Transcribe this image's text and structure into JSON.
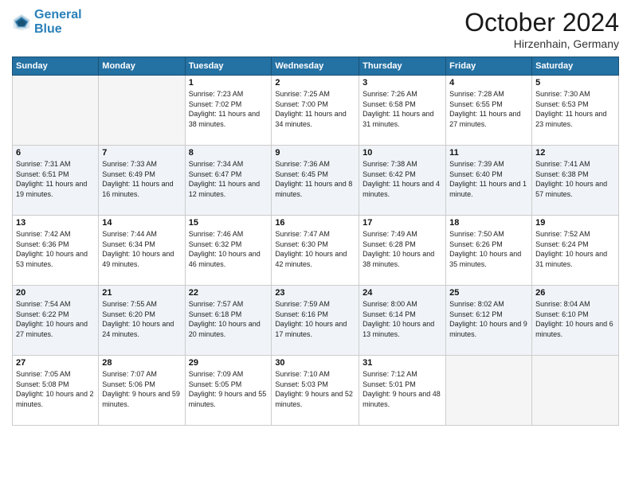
{
  "header": {
    "logo_line1": "General",
    "logo_line2": "Blue",
    "month": "October 2024",
    "location": "Hirzenhain, Germany"
  },
  "weekdays": [
    "Sunday",
    "Monday",
    "Tuesday",
    "Wednesday",
    "Thursday",
    "Friday",
    "Saturday"
  ],
  "weeks": [
    [
      {
        "day": "",
        "info": ""
      },
      {
        "day": "",
        "info": ""
      },
      {
        "day": "1",
        "info": "Sunrise: 7:23 AM\nSunset: 7:02 PM\nDaylight: 11 hours and 38 minutes."
      },
      {
        "day": "2",
        "info": "Sunrise: 7:25 AM\nSunset: 7:00 PM\nDaylight: 11 hours and 34 minutes."
      },
      {
        "day": "3",
        "info": "Sunrise: 7:26 AM\nSunset: 6:58 PM\nDaylight: 11 hours and 31 minutes."
      },
      {
        "day": "4",
        "info": "Sunrise: 7:28 AM\nSunset: 6:55 PM\nDaylight: 11 hours and 27 minutes."
      },
      {
        "day": "5",
        "info": "Sunrise: 7:30 AM\nSunset: 6:53 PM\nDaylight: 11 hours and 23 minutes."
      }
    ],
    [
      {
        "day": "6",
        "info": "Sunrise: 7:31 AM\nSunset: 6:51 PM\nDaylight: 11 hours and 19 minutes."
      },
      {
        "day": "7",
        "info": "Sunrise: 7:33 AM\nSunset: 6:49 PM\nDaylight: 11 hours and 16 minutes."
      },
      {
        "day": "8",
        "info": "Sunrise: 7:34 AM\nSunset: 6:47 PM\nDaylight: 11 hours and 12 minutes."
      },
      {
        "day": "9",
        "info": "Sunrise: 7:36 AM\nSunset: 6:45 PM\nDaylight: 11 hours and 8 minutes."
      },
      {
        "day": "10",
        "info": "Sunrise: 7:38 AM\nSunset: 6:42 PM\nDaylight: 11 hours and 4 minutes."
      },
      {
        "day": "11",
        "info": "Sunrise: 7:39 AM\nSunset: 6:40 PM\nDaylight: 11 hours and 1 minute."
      },
      {
        "day": "12",
        "info": "Sunrise: 7:41 AM\nSunset: 6:38 PM\nDaylight: 10 hours and 57 minutes."
      }
    ],
    [
      {
        "day": "13",
        "info": "Sunrise: 7:42 AM\nSunset: 6:36 PM\nDaylight: 10 hours and 53 minutes."
      },
      {
        "day": "14",
        "info": "Sunrise: 7:44 AM\nSunset: 6:34 PM\nDaylight: 10 hours and 49 minutes."
      },
      {
        "day": "15",
        "info": "Sunrise: 7:46 AM\nSunset: 6:32 PM\nDaylight: 10 hours and 46 minutes."
      },
      {
        "day": "16",
        "info": "Sunrise: 7:47 AM\nSunset: 6:30 PM\nDaylight: 10 hours and 42 minutes."
      },
      {
        "day": "17",
        "info": "Sunrise: 7:49 AM\nSunset: 6:28 PM\nDaylight: 10 hours and 38 minutes."
      },
      {
        "day": "18",
        "info": "Sunrise: 7:50 AM\nSunset: 6:26 PM\nDaylight: 10 hours and 35 minutes."
      },
      {
        "day": "19",
        "info": "Sunrise: 7:52 AM\nSunset: 6:24 PM\nDaylight: 10 hours and 31 minutes."
      }
    ],
    [
      {
        "day": "20",
        "info": "Sunrise: 7:54 AM\nSunset: 6:22 PM\nDaylight: 10 hours and 27 minutes."
      },
      {
        "day": "21",
        "info": "Sunrise: 7:55 AM\nSunset: 6:20 PM\nDaylight: 10 hours and 24 minutes."
      },
      {
        "day": "22",
        "info": "Sunrise: 7:57 AM\nSunset: 6:18 PM\nDaylight: 10 hours and 20 minutes."
      },
      {
        "day": "23",
        "info": "Sunrise: 7:59 AM\nSunset: 6:16 PM\nDaylight: 10 hours and 17 minutes."
      },
      {
        "day": "24",
        "info": "Sunrise: 8:00 AM\nSunset: 6:14 PM\nDaylight: 10 hours and 13 minutes."
      },
      {
        "day": "25",
        "info": "Sunrise: 8:02 AM\nSunset: 6:12 PM\nDaylight: 10 hours and 9 minutes."
      },
      {
        "day": "26",
        "info": "Sunrise: 8:04 AM\nSunset: 6:10 PM\nDaylight: 10 hours and 6 minutes."
      }
    ],
    [
      {
        "day": "27",
        "info": "Sunrise: 7:05 AM\nSunset: 5:08 PM\nDaylight: 10 hours and 2 minutes."
      },
      {
        "day": "28",
        "info": "Sunrise: 7:07 AM\nSunset: 5:06 PM\nDaylight: 9 hours and 59 minutes."
      },
      {
        "day": "29",
        "info": "Sunrise: 7:09 AM\nSunset: 5:05 PM\nDaylight: 9 hours and 55 minutes."
      },
      {
        "day": "30",
        "info": "Sunrise: 7:10 AM\nSunset: 5:03 PM\nDaylight: 9 hours and 52 minutes."
      },
      {
        "day": "31",
        "info": "Sunrise: 7:12 AM\nSunset: 5:01 PM\nDaylight: 9 hours and 48 minutes."
      },
      {
        "day": "",
        "info": ""
      },
      {
        "day": "",
        "info": ""
      }
    ]
  ]
}
